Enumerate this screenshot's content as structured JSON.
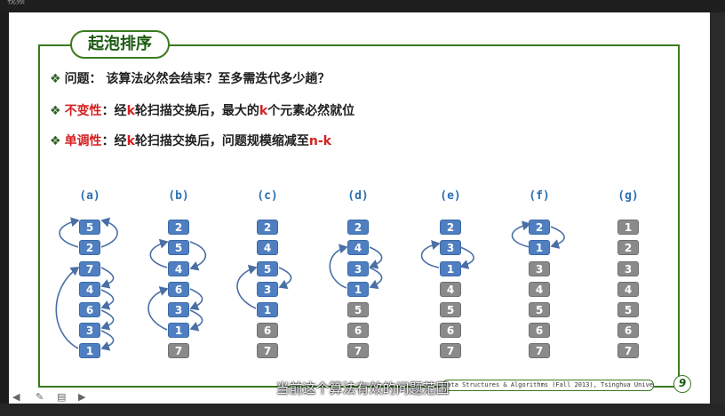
{
  "window": {
    "title": "视频"
  },
  "slide": {
    "title": "起泡排序",
    "bullets": [
      {
        "label": "问题：",
        "label_color": "#1f1f1f",
        "text": " 该算法必然会结束？至多需迭代多少趟？"
      },
      {
        "label": "不变性",
        "label_color": "#d42020",
        "parts": [
          "：经",
          "k",
          "轮扫描交换后，最大的",
          "k",
          "个元素必然就位"
        ]
      },
      {
        "label": "单调性",
        "label_color": "#d42020",
        "parts": [
          "：经",
          "k",
          "轮扫描交换后，问题规模缩减至",
          "n-k"
        ]
      }
    ],
    "stages": [
      {
        "label": "(a)",
        "values": [
          "5",
          "2",
          "7",
          "4",
          "6",
          "3",
          "1"
        ],
        "sorted_count": 0
      },
      {
        "label": "(b)",
        "values": [
          "2",
          "5",
          "4",
          "6",
          "3",
          "1",
          "7"
        ],
        "sorted_count": 1
      },
      {
        "label": "(c)",
        "values": [
          "2",
          "4",
          "5",
          "3",
          "1",
          "6",
          "7"
        ],
        "sorted_count": 2
      },
      {
        "label": "(d)",
        "values": [
          "2",
          "4",
          "3",
          "1",
          "5",
          "6",
          "7"
        ],
        "sorted_count": 3
      },
      {
        "label": "(e)",
        "values": [
          "2",
          "3",
          "1",
          "4",
          "5",
          "6",
          "7"
        ],
        "sorted_count": 4
      },
      {
        "label": "(f)",
        "values": [
          "2",
          "1",
          "3",
          "4",
          "5",
          "6",
          "7"
        ],
        "sorted_count": 5
      },
      {
        "label": "(g)",
        "values": [
          "1",
          "2",
          "3",
          "4",
          "5",
          "6",
          "7"
        ],
        "sorted_count": 7
      }
    ],
    "footer": "Data Structures & Algorithms (Fall 2013), Tsinghua University",
    "page_number": "9",
    "colors": {
      "unsorted": "#4f7fc0",
      "sorted": "#8a8a8a",
      "frame": "#3b7a1f",
      "arrow": "#4a6fa5"
    }
  },
  "player": {
    "subtitle": "当前这个算法有效的问题范围"
  }
}
